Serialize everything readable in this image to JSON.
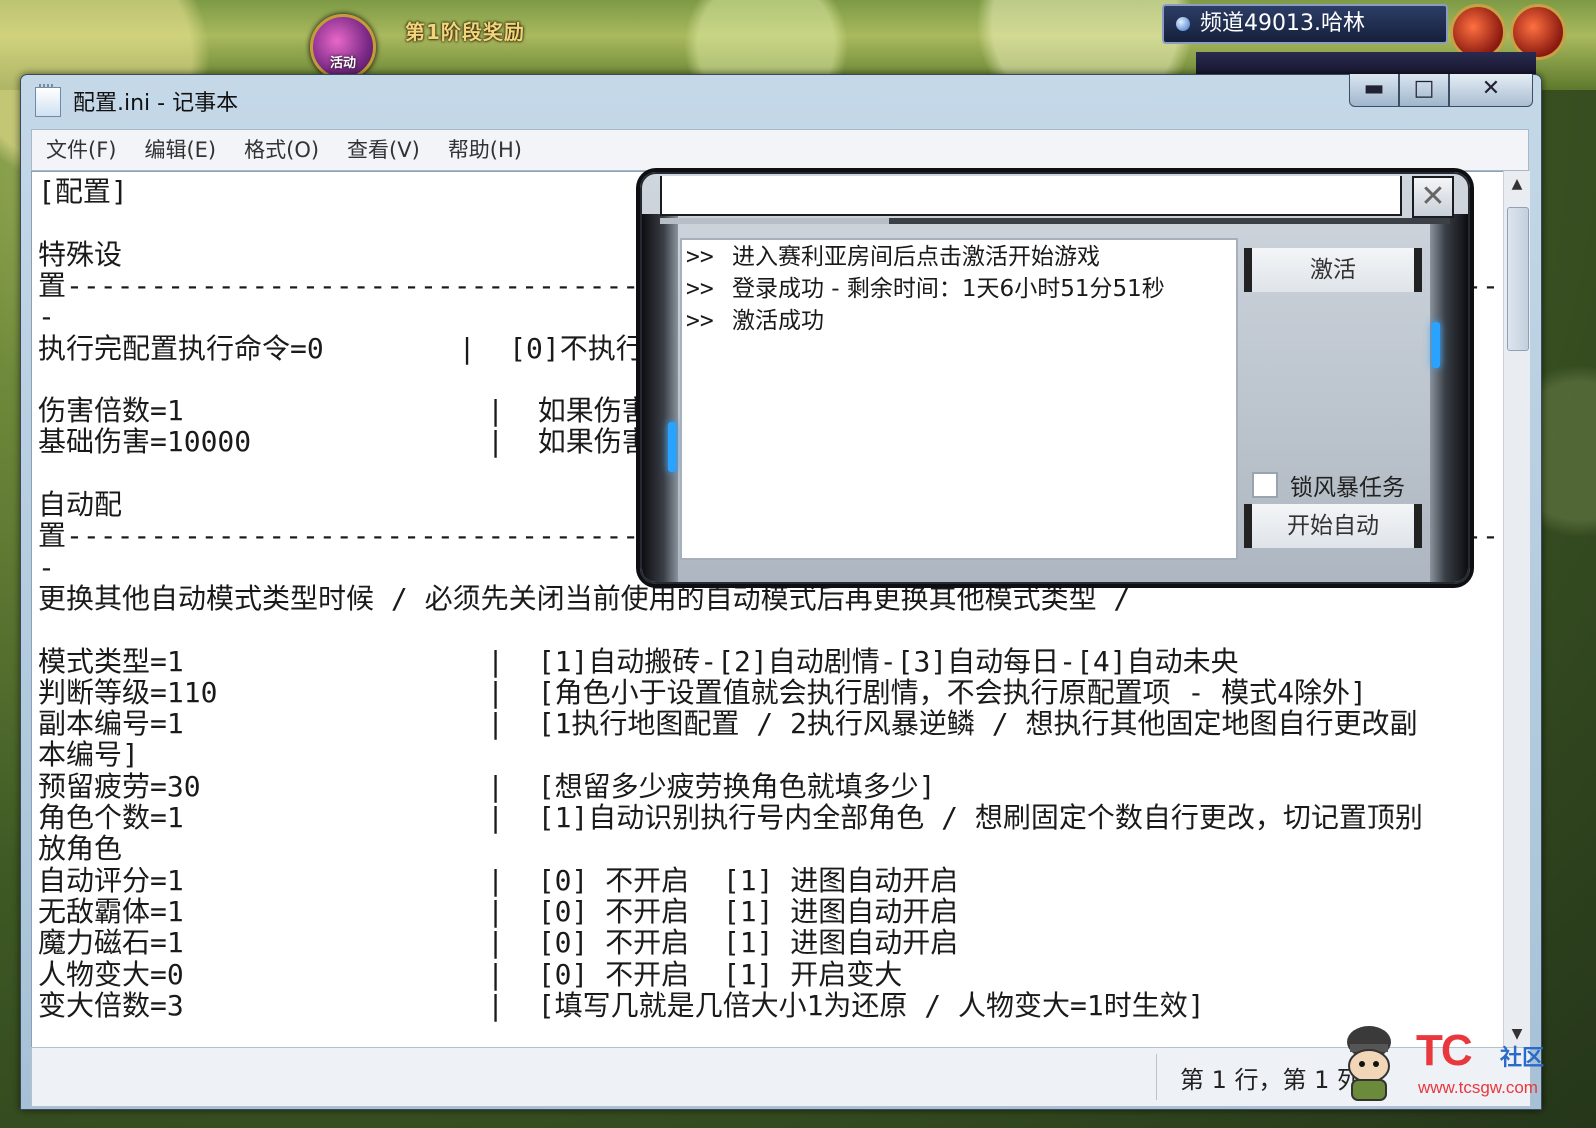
{
  "game": {
    "event_icon_label": "活动",
    "stage_reward": "第1阶段奖励",
    "channel": "频道49013.哈林"
  },
  "window": {
    "title": "配置.ini - 记事本",
    "min_label": "▬",
    "max_label": "□",
    "close_label": "✕"
  },
  "menu": [
    "文件(F)",
    "编辑(E)",
    "格式(O)",
    "查看(V)",
    "帮助(H)"
  ],
  "editor_lines": [
    "[配置]",
    "",
    "特殊设",
    "置------------------------------------------------------------------------------------------",
    "-",
    "执行完配置执行命令=0        |  [0]不执行",
    "",
    "伤害倍数=1                  |  如果伤害倍",
    "基础伤害=10000              |  如果伤害高",
    "",
    "自动配",
    "置------------------------------------------------------------------------------------------",
    "-",
    "更换其他自动模式类型时候 / 必须先关闭当前使用的自动模式后再更换其他模式类型 /",
    "",
    "模式类型=1                  |  [1]自动搬砖-[2]自动剧情-[3]自动每日-[4]自动未央",
    "判断等级=110                |  [角色小于设置值就会执行剧情，不会执行原配置项 - 模式4除外]",
    "副本编号=1                  |  [1执行地图配置 / 2执行风暴逆鳞 / 想执行其他固定地图自行更改副",
    "本编号]",
    "预留疲劳=30                 |  [想留多少疲劳换角色就填多少]",
    "角色个数=1                  |  [1]自动识别执行号内全部角色 / 想刷固定个数自行更改，切记置顶别",
    "放角色",
    "自动评分=1                  |  [0] 不开启  [1] 进图自动开启",
    "无敌霸体=1                  |  [0] 不开启  [1] 进图自动开启",
    "魔力磁石=1                  |  [0] 不开启  [1] 进图自动开启",
    "人物变大=0                  |  [0] 不开启  [1] 开启变大",
    "变大倍数=3                  |  [填写几就是几倍大小1为还原 / 人物变大=1时生效]"
  ],
  "status": {
    "position": "第 1 行，第 1 列"
  },
  "panel": {
    "close_label": "✕",
    "progress": 0.29,
    "log_prefix": ">>",
    "log": [
      "进入赛利亚房间后点击激活开始游戏",
      "登录成功 - 剩余时间：1天6小时51分51秒",
      "激活成功"
    ],
    "activate_label": "激活",
    "lock_label": "锁风暴任务",
    "lock_checked": false,
    "start_label": "开始自动"
  },
  "watermark": {
    "brand": "TC",
    "club": "社区",
    "url": "www.tcsgw.com"
  }
}
